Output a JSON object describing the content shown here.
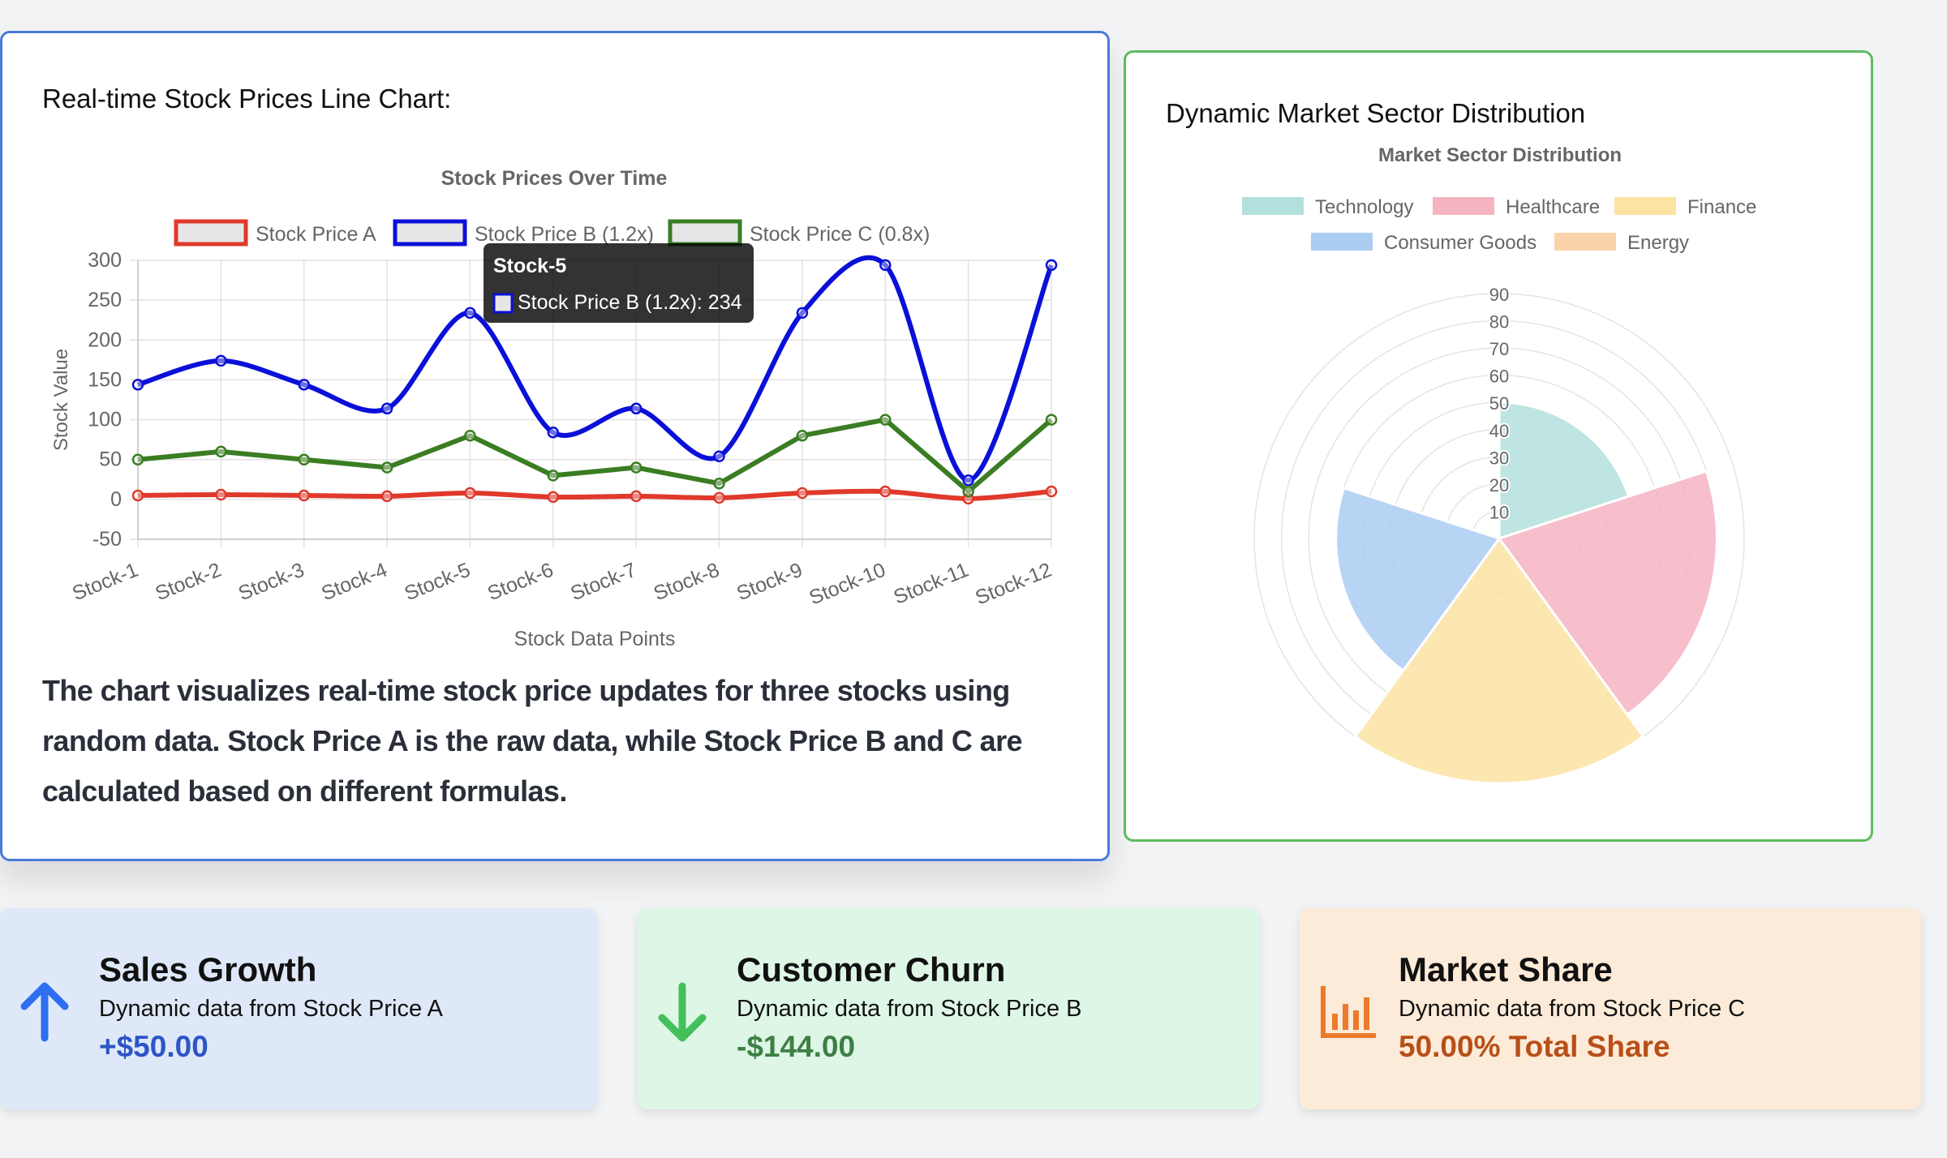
{
  "line_panel": {
    "heading": "Real-time Stock Prices Line Chart:",
    "description": "The chart visualizes real-time stock price updates for three stocks using random data. Stock Price A is the raw data, while Stock Price B and C are calculated based on different formulas.",
    "tooltip": {
      "title": "Stock-5",
      "label": "Stock Price B (1.2x): 234"
    }
  },
  "polar_panel": {
    "heading": "Dynamic Market Sector Distribution"
  },
  "chart_data": [
    {
      "type": "line",
      "title": "Stock Prices Over Time",
      "xlabel": "Stock Data Points",
      "ylabel": "Stock Value",
      "ylim": [
        -50,
        300
      ],
      "yticks": [
        300,
        250,
        200,
        150,
        100,
        50,
        0,
        -50
      ],
      "grid": true,
      "legend_position": "top",
      "categories": [
        "Stock-1",
        "Stock-2",
        "Stock-3",
        "Stock-4",
        "Stock-5",
        "Stock-6",
        "Stock-7",
        "Stock-8",
        "Stock-9",
        "Stock-10",
        "Stock-11",
        "Stock-12"
      ],
      "series": [
        {
          "name": "Stock Price A",
          "color": "#e0392b",
          "smooth": true,
          "values": [
            5,
            6,
            5,
            4,
            8,
            3,
            4,
            2,
            8,
            10,
            1,
            10
          ]
        },
        {
          "name": "Stock Price B (1.2x)",
          "color": "#0a10d8",
          "smooth": true,
          "values": [
            144,
            174,
            144,
            114,
            234,
            84,
            114,
            54,
            234,
            294,
            24,
            294
          ]
        },
        {
          "name": "Stock Price C (0.8x)",
          "color": "#3b7d23",
          "smooth": false,
          "values": [
            50,
            60,
            50,
            40,
            80,
            30,
            40,
            20,
            80,
            100,
            10,
            100
          ]
        }
      ]
    },
    {
      "type": "polarArea",
      "title": "Market Sector Distribution",
      "legend_position": "top",
      "r_ticks": [
        10,
        20,
        30,
        40,
        50,
        60,
        70,
        80,
        90
      ],
      "r_max": 90,
      "categories": [
        "Technology",
        "Healthcare",
        "Finance",
        "Consumer Goods",
        "Energy"
      ],
      "values": [
        50,
        80,
        90,
        60,
        0
      ],
      "colors": [
        "#b3e0dd",
        "#f5b4c2",
        "#fbe3a3",
        "#abcdf2",
        "#fbd3ab"
      ]
    }
  ],
  "stats": {
    "sales": {
      "title": "Sales Growth",
      "subtitle": "Dynamic data from Stock Price A",
      "value": "+$50.00",
      "icon": "arrow-up-icon",
      "color": "#2d6ff0"
    },
    "churn": {
      "title": "Customer Churn",
      "subtitle": "Dynamic data from Stock Price B",
      "value": "-$144.00",
      "icon": "arrow-down-icon",
      "color": "#43c05a"
    },
    "share": {
      "title": "Market Share",
      "subtitle": "Dynamic data from Stock Price C",
      "value": "50.00% Total Share",
      "icon": "bar-chart-icon",
      "color": "#ec7a2c"
    }
  }
}
